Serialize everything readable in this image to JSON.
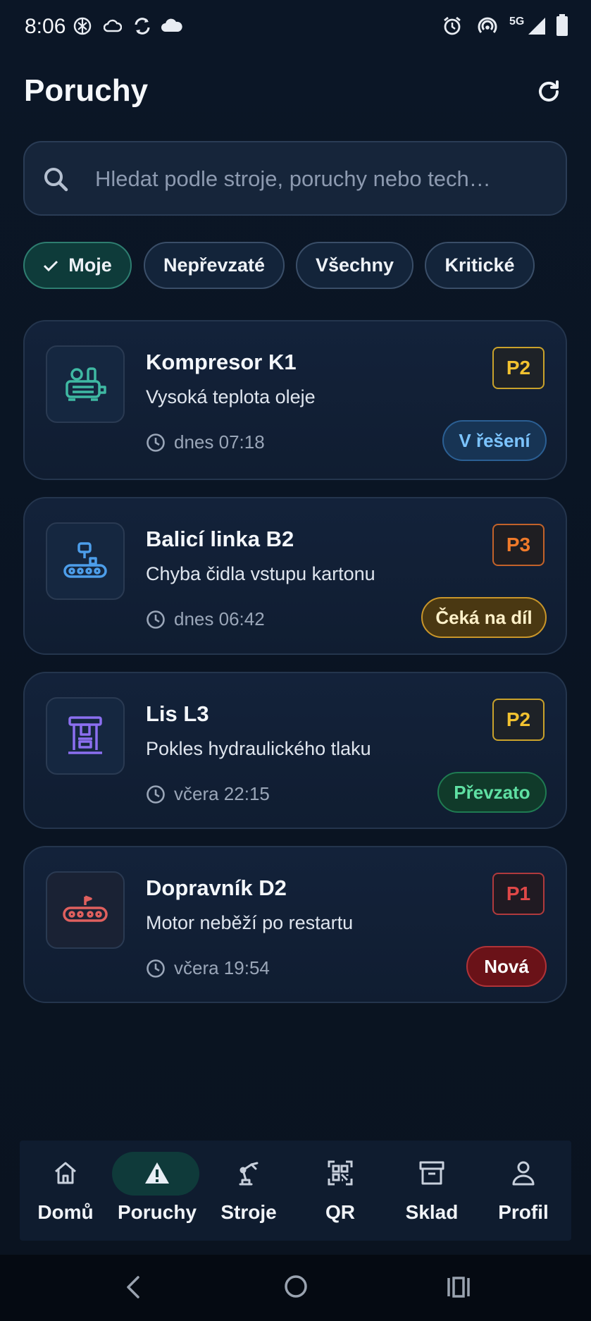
{
  "status_bar": {
    "time": "8:06",
    "network": "5G"
  },
  "header": {
    "title": "Poruchy"
  },
  "search": {
    "placeholder": "Hledat podle stroje, poruchy nebo tech…"
  },
  "filters": [
    {
      "label": "Moje",
      "active": true
    },
    {
      "label": "Nepřevzaté",
      "active": false
    },
    {
      "label": "Všechny",
      "active": false
    },
    {
      "label": "Kritické",
      "active": false
    }
  ],
  "faults": [
    {
      "machine": "Kompresor K1",
      "description": "Vysoká teplota oleje",
      "time": "dnes 07:18",
      "priority": "P2",
      "status": "V řešení",
      "icon": "compressor-icon"
    },
    {
      "machine": "Balicí linka B2",
      "description": "Chyba čidla vstupu kartonu",
      "time": "dnes 06:42",
      "priority": "P3",
      "status": "Čeká na díl",
      "icon": "packaging-line-icon"
    },
    {
      "machine": "Lis L3",
      "description": "Pokles hydraulického tlaku",
      "time": "včera 22:15",
      "priority": "P2",
      "status": "Převzato",
      "icon": "press-icon"
    },
    {
      "machine": "Dopravník D2",
      "description": "Motor neběží po restartu",
      "time": "včera 19:54",
      "priority": "P1",
      "status": "Nová",
      "icon": "conveyor-icon"
    }
  ],
  "colors": {
    "accent": "#2e7d70",
    "priority_p1": "#e04848",
    "priority_p2": "#f2c230",
    "priority_p3": "#f07a2a",
    "status_in_progress": "#7cc4ff",
    "status_waiting": "#f5c242",
    "status_taken": "#5fe0a3",
    "status_new": "#ffffff"
  },
  "bottom_nav": [
    {
      "label": "Domů",
      "icon": "home-icon",
      "active": false
    },
    {
      "label": "Poruchy",
      "icon": "warning-icon",
      "active": true
    },
    {
      "label": "Stroje",
      "icon": "robot-arm-icon",
      "active": false
    },
    {
      "label": "QR",
      "icon": "qr-icon",
      "active": false
    },
    {
      "label": "Sklad",
      "icon": "archive-icon",
      "active": false
    },
    {
      "label": "Profil",
      "icon": "user-icon",
      "active": false
    }
  ]
}
